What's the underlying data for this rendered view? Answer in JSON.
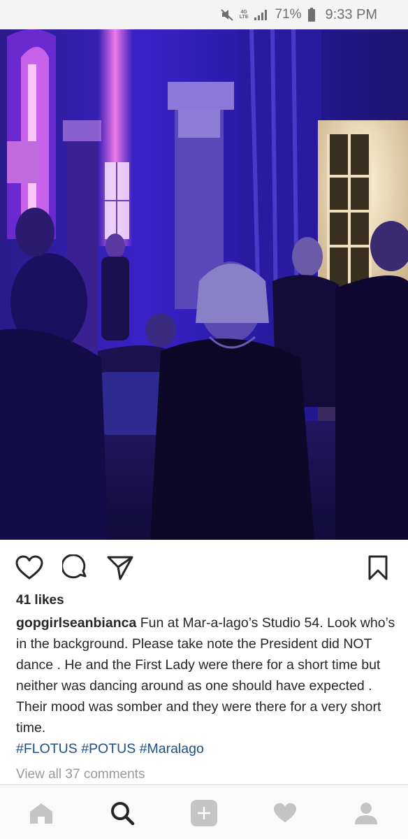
{
  "status_bar": {
    "battery_percent": "71%",
    "time": "9:33 PM",
    "network_top": "4G",
    "network_bottom": "LTE",
    "icons": [
      "mute-icon",
      "network-icon",
      "signal-icon",
      "battery-icon"
    ]
  },
  "post": {
    "image_icon": "party-photo",
    "likes": "41 likes",
    "username": "gopgirlseanbianca",
    "caption_text": " Fun at Mar-a-lago’s Studio 54. Look who’s in the background. Please take note the President did NOT dance . He and the First Lady were there for a short time but neither was dancing around as one should have expected . Their mood was somber and they were there for a very short time.",
    "hashtags": [
      "#FLOTUS",
      "#POTUS",
      "#Maralago"
    ],
    "view_comments": "View all 37 comments"
  },
  "actions": [
    "heart-icon",
    "comment-icon",
    "share-icon",
    "bookmark-icon"
  ],
  "bottom_nav": [
    "home-icon",
    "search-icon",
    "add-icon",
    "activity-icon",
    "profile-icon"
  ],
  "colors": {
    "hashtag": "#1d4f86",
    "muted_text": "#999999",
    "status_bar_bg": "#f4f4f4",
    "nav_icon": "#c4c4c4"
  }
}
